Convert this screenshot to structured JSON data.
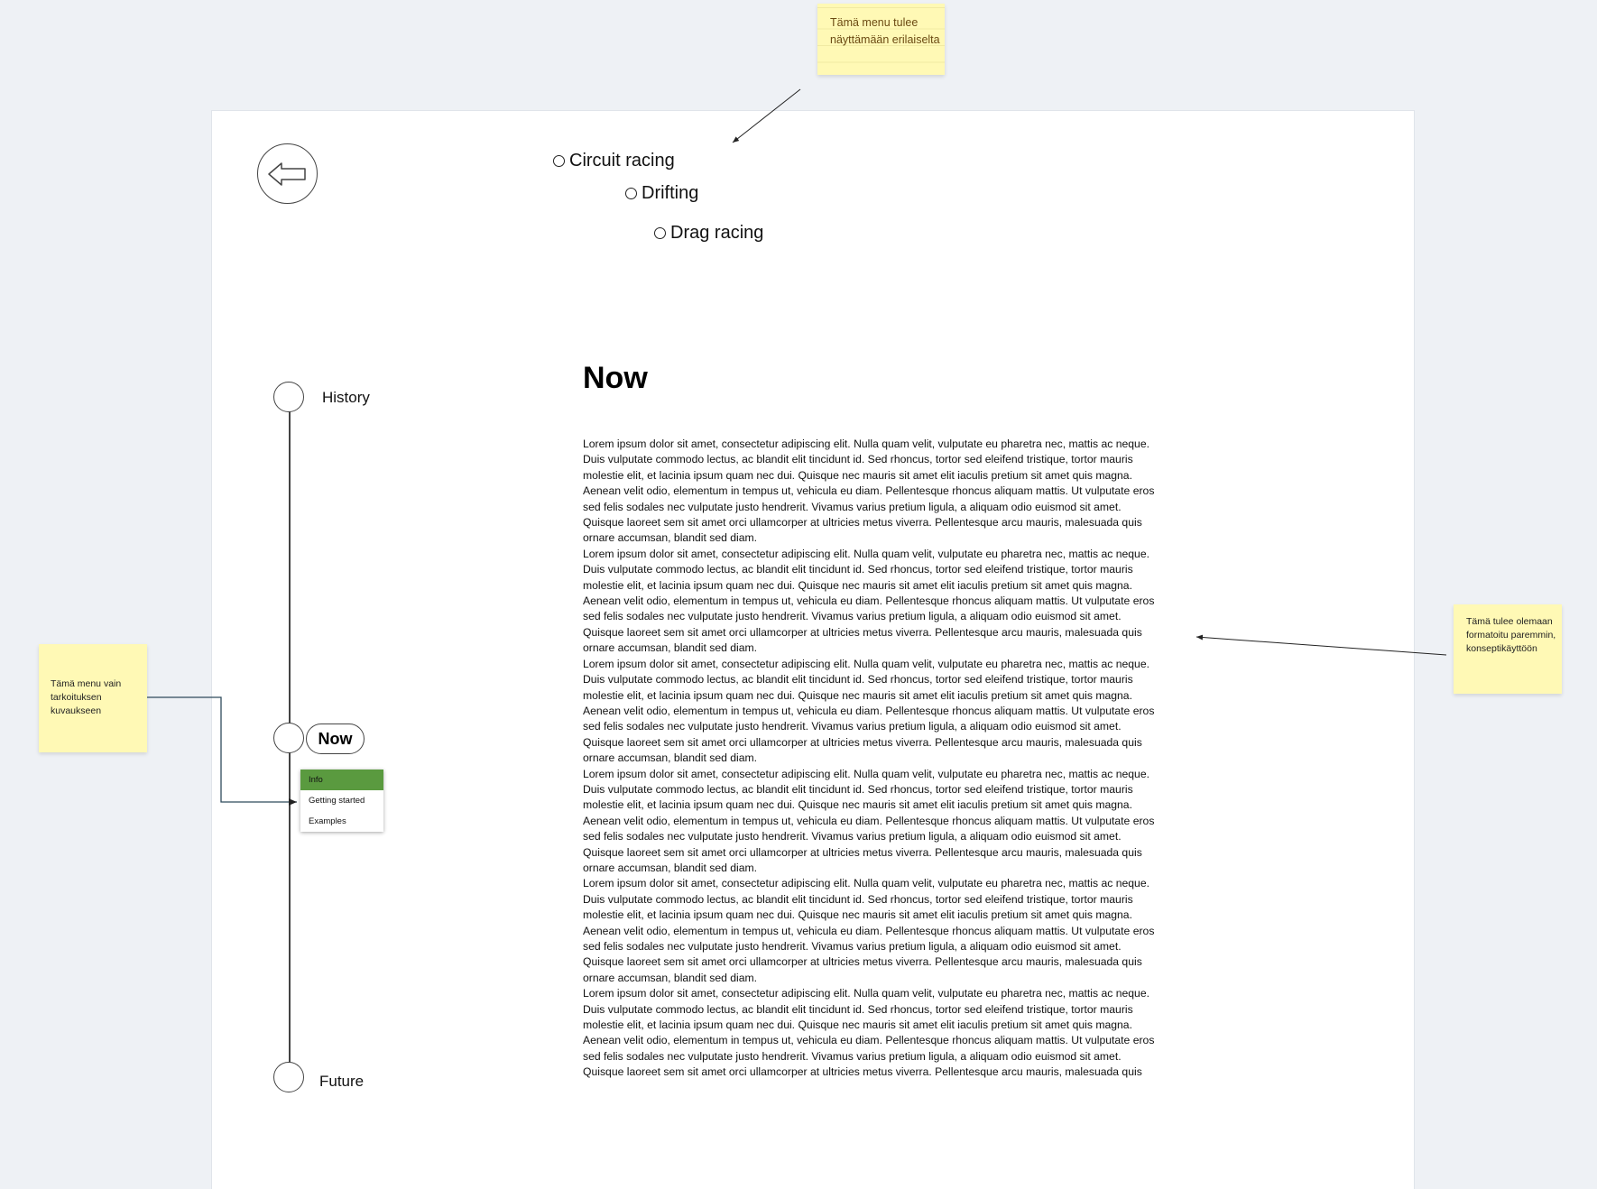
{
  "race_options": [
    "Circuit racing",
    "Drifting",
    "Drag racing"
  ],
  "timeline": {
    "history": "History",
    "now": "Now",
    "future": "Future"
  },
  "submenu": {
    "items": [
      "Info",
      "Getting started",
      "Examples"
    ],
    "active_color": "#5a9a3f"
  },
  "content": {
    "heading": "Now",
    "paragraph": "Lorem ipsum dolor sit amet, consectetur adipiscing elit. Nulla quam velit, vulputate eu pharetra nec, mattis ac neque. Duis vulputate commodo lectus, ac blandit elit tincidunt id. Sed rhoncus, tortor sed eleifend tristique, tortor mauris molestie elit, et lacinia ipsum quam nec dui. Quisque nec mauris sit amet elit iaculis pretium sit amet quis magna. Aenean velit odio, elementum in tempus ut, vehicula eu diam. Pellentesque rhoncus aliquam mattis. Ut vulputate eros sed felis sodales nec vulputate justo hendrerit. Vivamus varius pretium ligula, a aliquam odio euismod sit amet. Quisque laoreet sem sit amet orci ullamcorper at ultricies metus viverra. Pellentesque arcu mauris, malesuada quis ornare accumsan, blandit sed diam."
  },
  "notes": {
    "top": "Tämä menu tulee näyttämään erilaiselta",
    "left": "Tämä menu vain tarkoituksen kuvaukseen",
    "right": "Tämä tulee olemaan formatoitu paremmin, konseptikäyttöön"
  },
  "icons": {
    "back": "back-arrow-icon"
  }
}
